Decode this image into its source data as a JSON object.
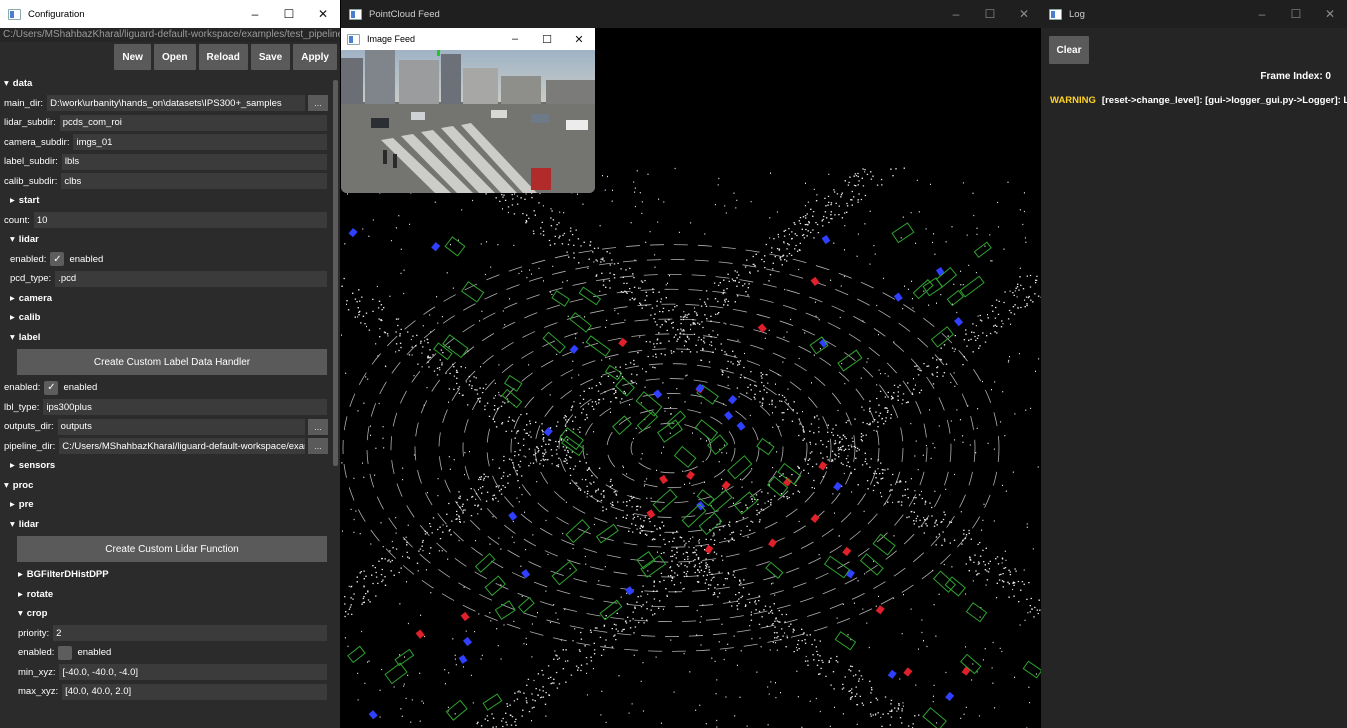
{
  "config_window": {
    "title": "Configuration",
    "path": "C:/Users/MShahbazKharal/liguard-default-workspace/examples/test_pipeline",
    "toolbar": [
      "New",
      "Open",
      "Reload",
      "Save",
      "Apply"
    ],
    "window_controls": [
      "–",
      "☐",
      "✕"
    ],
    "tree": [
      {
        "type": "header",
        "indent": 0,
        "arrow": "▾",
        "label": "data"
      },
      {
        "type": "field",
        "indent": 0,
        "label": "main_dir:",
        "value": "D:\\work\\urbanity\\hands_on\\datasets\\IPS300+_samples",
        "browse": true
      },
      {
        "type": "field",
        "indent": 0,
        "label": "lidar_subdir:",
        "value": "pcds_com_roi"
      },
      {
        "type": "field",
        "indent": 0,
        "label": "camera_subdir:",
        "value": "imgs_01"
      },
      {
        "type": "field",
        "indent": 0,
        "label": "label_subdir:",
        "value": "lbls"
      },
      {
        "type": "field",
        "indent": 0,
        "label": "calib_subdir:",
        "value": "clbs"
      },
      {
        "type": "header",
        "indent": 1,
        "arrow": "▸",
        "label": "start"
      },
      {
        "type": "field",
        "indent": 0,
        "label": "count:",
        "value": "10"
      },
      {
        "type": "header",
        "indent": 1,
        "arrow": "▾",
        "label": "lidar"
      },
      {
        "type": "check",
        "indent": 1,
        "label": "enabled:",
        "checked": true,
        "text": "enabled"
      },
      {
        "type": "field",
        "indent": 1,
        "label": "pcd_type:",
        "value": ".pcd"
      },
      {
        "type": "header",
        "indent": 1,
        "arrow": "▸",
        "label": "camera"
      },
      {
        "type": "header",
        "indent": 1,
        "arrow": "▸",
        "label": "calib"
      },
      {
        "type": "header",
        "indent": 1,
        "arrow": "▾",
        "label": "label"
      },
      {
        "type": "button",
        "label": "Create Custom Label Data Handler"
      },
      {
        "type": "check",
        "indent": 0,
        "label": "enabled:",
        "checked": true,
        "text": "enabled"
      },
      {
        "type": "field",
        "indent": 0,
        "label": "lbl_type:",
        "value": "ips300plus"
      },
      {
        "type": "field",
        "indent": 0,
        "label": "outputs_dir:",
        "value": "outputs",
        "browse": true
      },
      {
        "type": "field",
        "indent": 0,
        "label": "pipeline_dir:",
        "value": "C:/Users/MShahbazKharal/liguard-default-workspace/examples/test_pipeline",
        "browse": true
      },
      {
        "type": "header",
        "indent": 1,
        "arrow": "▸",
        "label": "sensors"
      },
      {
        "type": "header",
        "indent": 0,
        "arrow": "▾",
        "label": "proc"
      },
      {
        "type": "header",
        "indent": 1,
        "arrow": "▸",
        "label": "pre"
      },
      {
        "type": "header",
        "indent": 1,
        "arrow": "▾",
        "label": "lidar"
      },
      {
        "type": "button",
        "label": "Create Custom Lidar Function"
      },
      {
        "type": "header",
        "indent": 2,
        "arrow": "▸",
        "label": "BGFilterDHistDPP"
      },
      {
        "type": "header",
        "indent": 2,
        "arrow": "▸",
        "label": "rotate"
      },
      {
        "type": "header",
        "indent": 2,
        "arrow": "▾",
        "label": "crop"
      },
      {
        "type": "field",
        "indent": 2,
        "label": "priority:",
        "value": "2"
      },
      {
        "type": "check",
        "indent": 2,
        "label": "enabled:",
        "checked": false,
        "text": "enabled"
      },
      {
        "type": "field",
        "indent": 2,
        "label": "min_xyz:",
        "value": "[-40.0, -40.0, -4.0]"
      },
      {
        "type": "field",
        "indent": 2,
        "label": "max_xyz:",
        "value": "[40.0, 40.0, 2.0]"
      }
    ]
  },
  "pointcloud_window": {
    "title": "PointCloud Feed",
    "window_controls": [
      "–",
      "☐",
      "✕"
    ],
    "image_feed": {
      "title": "Image Feed",
      "window_controls": [
        "–",
        "☐",
        "✕"
      ]
    }
  },
  "log_window": {
    "title": "Log",
    "window_controls": [
      "–",
      "☐",
      "✕"
    ],
    "clear_label": "Clear",
    "frame_index": "Frame Index: 0",
    "entries": [
      {
        "level": "WARNING",
        "message": "[reset->change_level]: [gui->logger_gui.py->Logger]: Logger level changed"
      }
    ]
  },
  "colors": {
    "panel_bg": "#2b2b2b",
    "field_bg": "#3b3b3b",
    "button_bg": "#5a5a5a",
    "warning": "#ffd32a",
    "box_green": "#2fa32f",
    "box_red": "#e0202a",
    "box_blue": "#3040ff"
  }
}
